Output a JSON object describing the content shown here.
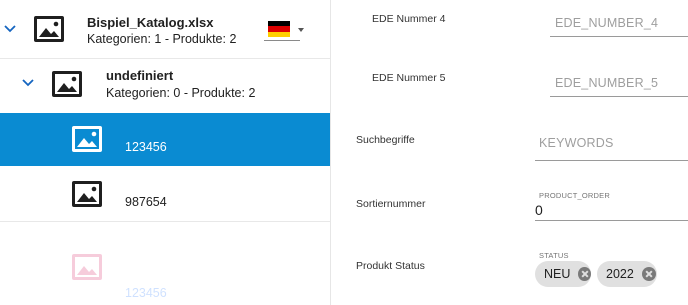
{
  "tree": {
    "catalog": {
      "name": "Bispiel_Katalog.xlsx",
      "meta": "Kategorien: 1 - Produkte: 2",
      "flag_colors": [
        "#000000",
        "#dd0000",
        "#ffce00"
      ]
    },
    "category": {
      "name": "undefiniert",
      "meta": "Kategorien: 0 - Produkte: 2"
    },
    "products": [
      {
        "code": "123456",
        "selected": true
      },
      {
        "code": "987654",
        "selected": false
      }
    ],
    "ghost_code": "123456",
    "colors": {
      "selected_bg": "#0a8bd2",
      "icon": "#1f1f1f",
      "chevron": "#1565c0"
    }
  },
  "form": {
    "ede4": {
      "label": "EDE Nummer 4",
      "placeholder": "EDE_NUMBER_4"
    },
    "ede5": {
      "label": "EDE Nummer 5",
      "placeholder": "EDE_NUMBER_5"
    },
    "keywords": {
      "label": "Suchbegriffe",
      "placeholder": "KEYWORDS"
    },
    "order": {
      "label": "Sortiernummer",
      "floating_label": "PRODUCT_ORDER",
      "value": "0"
    },
    "status": {
      "label": "Produkt Status",
      "floating_label": "STATUS",
      "chips": [
        "NEU",
        "2022"
      ]
    }
  }
}
